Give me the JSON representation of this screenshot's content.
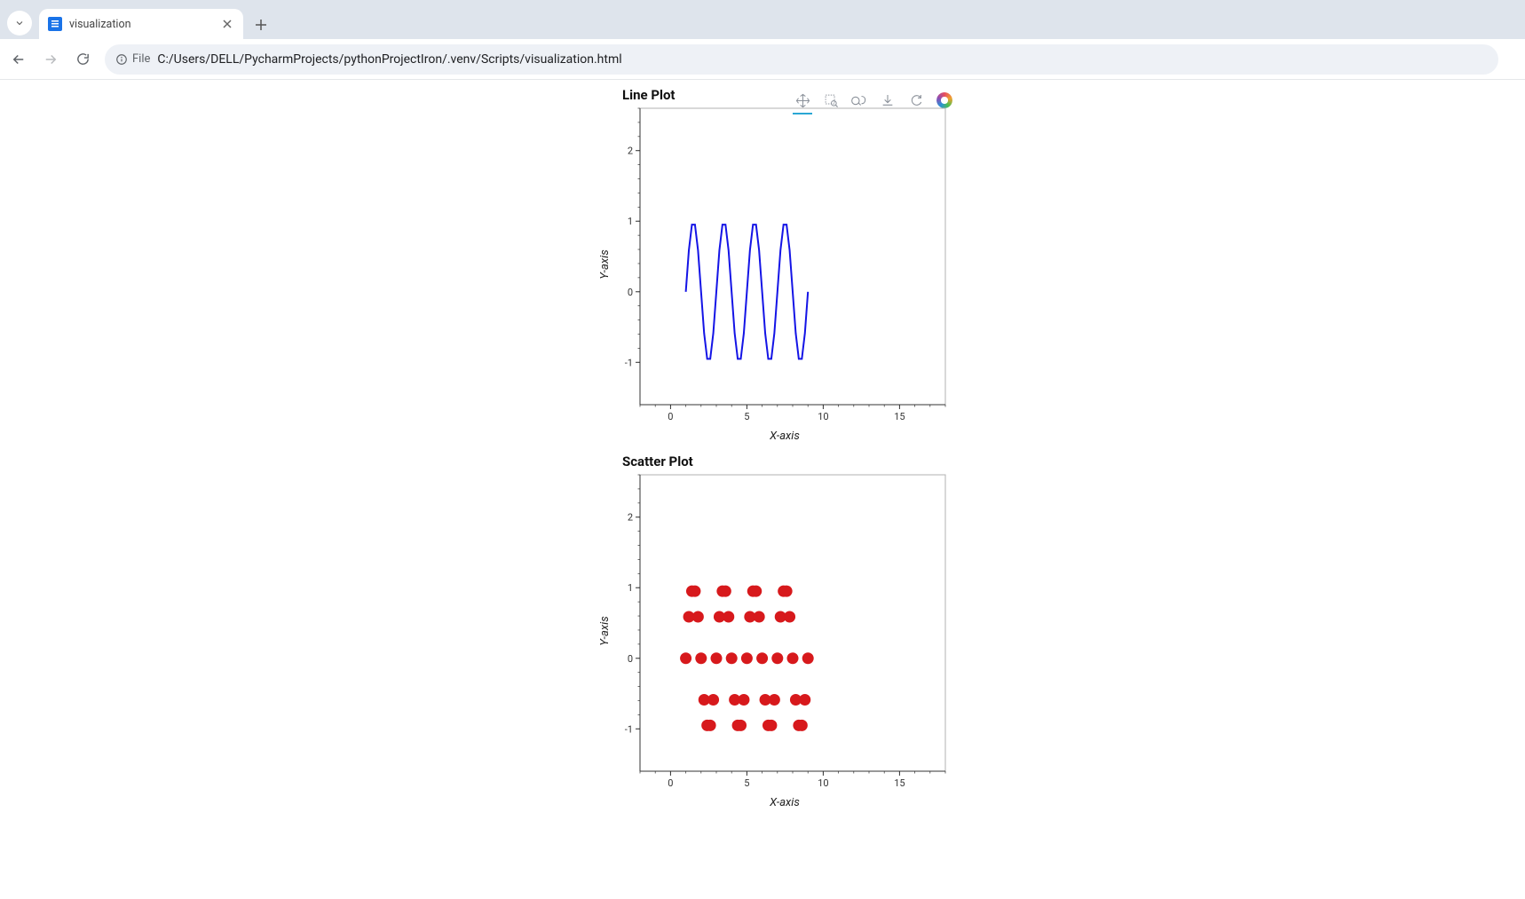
{
  "browser": {
    "tab_title": "visualization",
    "file_chip": "File",
    "url": "C:/Users/DELL/PycharmProjects/pythonProjectIron/.venv/Scripts/visualization.html"
  },
  "toolbar": {
    "tools": [
      "pan",
      "box-zoom",
      "wheel-zoom",
      "save",
      "reset",
      "logo"
    ],
    "active": "pan"
  },
  "chart_data": [
    {
      "type": "line",
      "title": "Line Plot",
      "xlabel": "X-axis",
      "ylabel": "Y-axis",
      "xlim": [
        -2,
        18
      ],
      "ylim": [
        -1.6,
        2.6
      ],
      "xticks": [
        0,
        5,
        10,
        15
      ],
      "yticks": [
        -1,
        0,
        1,
        2
      ],
      "color": "#1414e6",
      "x": [
        1.0,
        1.2,
        1.4,
        1.6,
        1.8,
        2.0,
        2.2,
        2.4,
        2.6,
        2.8,
        3.0,
        3.2,
        3.4,
        3.6,
        3.8,
        4.0,
        4.2,
        4.4,
        4.6,
        4.8,
        5.0,
        5.2,
        5.4,
        5.6,
        5.8,
        6.0,
        6.2,
        6.4,
        6.6,
        6.8,
        7.0,
        7.2,
        7.4,
        7.6,
        7.8,
        8.0,
        8.2,
        8.4,
        8.6,
        8.8,
        9.0
      ],
      "y": [
        0.0,
        0.588,
        0.951,
        0.951,
        0.588,
        0.0,
        -0.588,
        -0.951,
        -0.951,
        -0.588,
        0.0,
        0.588,
        0.951,
        0.951,
        0.588,
        0.0,
        -0.588,
        -0.951,
        -0.951,
        -0.588,
        0.0,
        0.588,
        0.951,
        0.951,
        0.588,
        0.0,
        -0.588,
        -0.951,
        -0.951,
        -0.588,
        0.0,
        0.588,
        0.951,
        0.951,
        0.588,
        0.0,
        -0.588,
        -0.951,
        -0.951,
        -0.588,
        0.0
      ]
    },
    {
      "type": "scatter",
      "title": "Scatter Plot",
      "xlabel": "X-axis",
      "ylabel": "Y-axis",
      "xlim": [
        -2,
        18
      ],
      "ylim": [
        -1.6,
        2.6
      ],
      "xticks": [
        0,
        5,
        10,
        15
      ],
      "yticks": [
        -1,
        0,
        1,
        2
      ],
      "color": "#d7191c",
      "x": [
        1.0,
        1.2,
        1.4,
        1.6,
        1.8,
        2.0,
        2.2,
        2.4,
        2.6,
        2.8,
        3.0,
        3.2,
        3.4,
        3.6,
        3.8,
        4.0,
        4.2,
        4.4,
        4.6,
        4.8,
        5.0,
        5.2,
        5.4,
        5.6,
        5.8,
        6.0,
        6.2,
        6.4,
        6.6,
        6.8,
        7.0,
        7.2,
        7.4,
        7.6,
        7.8,
        8.0,
        8.2,
        8.4,
        8.6,
        8.8,
        9.0
      ],
      "y": [
        0.0,
        0.588,
        0.951,
        0.951,
        0.588,
        0.0,
        -0.588,
        -0.951,
        -0.951,
        -0.588,
        0.0,
        0.588,
        0.951,
        0.951,
        0.588,
        0.0,
        -0.588,
        -0.951,
        -0.951,
        -0.588,
        0.0,
        0.588,
        0.951,
        0.951,
        0.588,
        0.0,
        -0.588,
        -0.951,
        -0.951,
        -0.588,
        0.0,
        0.588,
        0.951,
        0.951,
        0.588,
        0.0,
        -0.588,
        -0.951,
        -0.951,
        -0.588,
        0.0
      ]
    }
  ]
}
